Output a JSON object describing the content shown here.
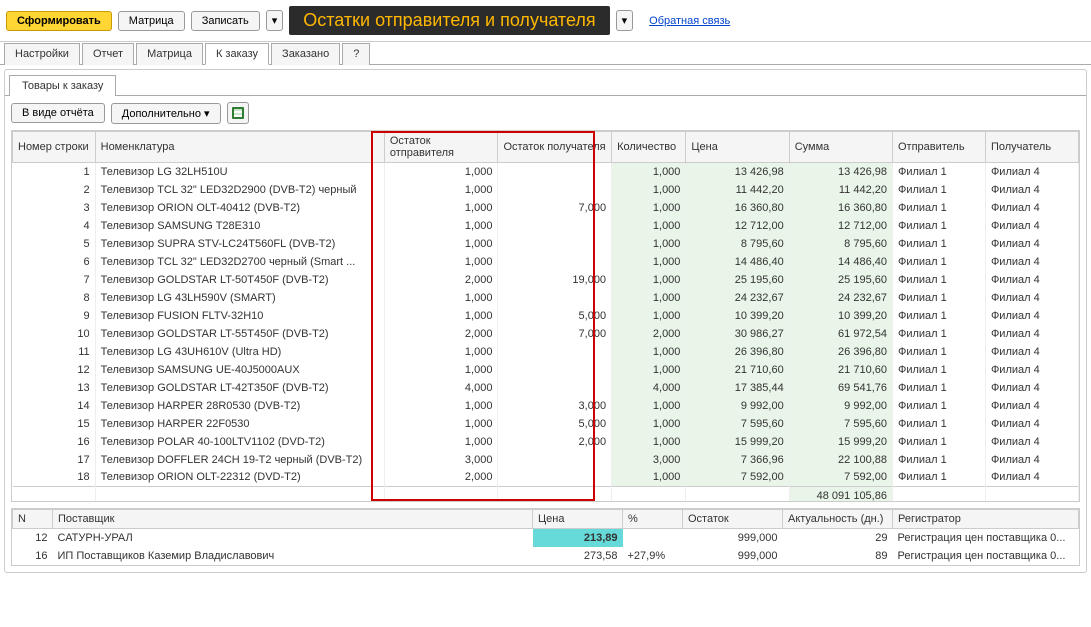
{
  "toolbar": {
    "form_button": "Сформировать",
    "matrix_button": "Матрица",
    "save_button": "Записать",
    "banner": "Остатки отправителя и получателя",
    "feedback_link": "Обратная связь"
  },
  "tabs_main": {
    "settings": "Настройки",
    "report": "Отчет",
    "matrix": "Матрица",
    "to_order": "К заказу",
    "ordered": "Заказано",
    "help": "?"
  },
  "tabs_sub": {
    "goods_to_order": "Товары к заказу"
  },
  "subtoolbar": {
    "report_view": "В виде отчёта",
    "additional": "Дополнительно"
  },
  "grid_headers": {
    "row_num": "Номер строки",
    "nomenclature": "Номенклатура",
    "sender_stock": "Остаток отправителя",
    "receiver_stock": "Остаток получателя",
    "quantity": "Количество",
    "price": "Цена",
    "sum": "Сумма",
    "sender": "Отправитель",
    "receiver": "Получатель"
  },
  "rows": [
    {
      "n": 1,
      "name": "Телевизор LG 32LH510U",
      "ostotp": "1,000",
      "ostpol": "",
      "qty": "1,000",
      "price": "13 426,98",
      "sum": "13 426,98",
      "otp": "Филиал 1",
      "pol": "Филиал 4"
    },
    {
      "n": 2,
      "name": "Телевизор TCL 32\" LED32D2900 (DVB-T2) черный",
      "ostotp": "1,000",
      "ostpol": "",
      "qty": "1,000",
      "price": "11 442,20",
      "sum": "11 442,20",
      "otp": "Филиал 1",
      "pol": "Филиал 4"
    },
    {
      "n": 3,
      "name": "Телевизор ORION OLT-40412 (DVB-T2)",
      "ostotp": "1,000",
      "ostpol": "7,000",
      "qty": "1,000",
      "price": "16 360,80",
      "sum": "16 360,80",
      "otp": "Филиал 1",
      "pol": "Филиал 4"
    },
    {
      "n": 4,
      "name": "Телевизор SAMSUNG T28E310",
      "ostotp": "1,000",
      "ostpol": "",
      "qty": "1,000",
      "price": "12 712,00",
      "sum": "12 712,00",
      "otp": "Филиал 1",
      "pol": "Филиал 4"
    },
    {
      "n": 5,
      "name": "Телевизор SUPRA STV-LC24T560FL (DVB-T2)",
      "ostotp": "1,000",
      "ostpol": "",
      "qty": "1,000",
      "price": "8 795,60",
      "sum": "8 795,60",
      "otp": "Филиал 1",
      "pol": "Филиал 4"
    },
    {
      "n": 6,
      "name": "Телевизор TCL 32\" LED32D2700 черный (Smart ...",
      "ostotp": "1,000",
      "ostpol": "",
      "qty": "1,000",
      "price": "14 486,40",
      "sum": "14 486,40",
      "otp": "Филиал 1",
      "pol": "Филиал 4"
    },
    {
      "n": 7,
      "name": "Телевизор GOLDSTAR LT-50T450F (DVB-T2)",
      "ostotp": "2,000",
      "ostpol": "19,000",
      "qty": "1,000",
      "price": "25 195,60",
      "sum": "25 195,60",
      "otp": "Филиал 1",
      "pol": "Филиал 4"
    },
    {
      "n": 8,
      "name": "Телевизор LG 43LH590V (SMART)",
      "ostotp": "1,000",
      "ostpol": "",
      "qty": "1,000",
      "price": "24 232,67",
      "sum": "24 232,67",
      "otp": "Филиал 1",
      "pol": "Филиал 4"
    },
    {
      "n": 9,
      "name": "Телевизор FUSION FLTV-32H10",
      "ostotp": "1,000",
      "ostpol": "5,000",
      "qty": "1,000",
      "price": "10 399,20",
      "sum": "10 399,20",
      "otp": "Филиал 1",
      "pol": "Филиал 4"
    },
    {
      "n": 10,
      "name": "Телевизор GOLDSTAR LT-55T450F (DVB-T2)",
      "ostotp": "2,000",
      "ostpol": "7,000",
      "qty": "2,000",
      "price": "30 986,27",
      "sum": "61 972,54",
      "otp": "Филиал 1",
      "pol": "Филиал 4"
    },
    {
      "n": 11,
      "name": "Телевизор LG 43UH610V (Ultra HD)",
      "ostotp": "1,000",
      "ostpol": "",
      "qty": "1,000",
      "price": "26 396,80",
      "sum": "26 396,80",
      "otp": "Филиал 1",
      "pol": "Филиал 4"
    },
    {
      "n": 12,
      "name": "Телевизор SAMSUNG UE-40J5000AUX",
      "ostotp": "1,000",
      "ostpol": "",
      "qty": "1,000",
      "price": "21 710,60",
      "sum": "21 710,60",
      "otp": "Филиал 1",
      "pol": "Филиал 4"
    },
    {
      "n": 13,
      "name": "Телевизор GOLDSTAR LT-42T350F (DVB-T2)",
      "ostotp": "4,000",
      "ostpol": "",
      "qty": "4,000",
      "price": "17 385,44",
      "sum": "69 541,76",
      "otp": "Филиал 1",
      "pol": "Филиал 4"
    },
    {
      "n": 14,
      "name": "Телевизор HARPER 28R0530 (DVB-T2)",
      "ostotp": "1,000",
      "ostpol": "3,000",
      "qty": "1,000",
      "price": "9 992,00",
      "sum": "9 992,00",
      "otp": "Филиал 1",
      "pol": "Филиал 4"
    },
    {
      "n": 15,
      "name": "Телевизор HARPER 22F0530",
      "ostotp": "1,000",
      "ostpol": "5,000",
      "qty": "1,000",
      "price": "7 595,60",
      "sum": "7 595,60",
      "otp": "Филиал 1",
      "pol": "Филиал 4"
    },
    {
      "n": 16,
      "name": "Телевизор POLAR 40-100LTV1102 (DVD-T2)",
      "ostotp": "1,000",
      "ostpol": "2,000",
      "qty": "1,000",
      "price": "15 999,20",
      "sum": "15 999,20",
      "otp": "Филиал 1",
      "pol": "Филиал 4"
    },
    {
      "n": 17,
      "name": "Телевизор DOFFLER 24CH 19-T2 черный (DVB-T2)",
      "ostotp": "3,000",
      "ostpol": "",
      "qty": "3,000",
      "price": "7 366,96",
      "sum": "22 100,88",
      "otp": "Филиал 1",
      "pol": "Филиал 4"
    },
    {
      "n": 18,
      "name": "Телевизор ORION OLT-22312 (DVD-T2)",
      "ostotp": "2,000",
      "ostpol": "",
      "qty": "1,000",
      "price": "7 592,00",
      "sum": "7 592,00",
      "otp": "Филиал 1",
      "pol": "Филиал 4"
    }
  ],
  "totals": {
    "sum": "48 091 105,86"
  },
  "bottom_headers": {
    "n": "N",
    "supplier": "Поставщик",
    "price": "Цена",
    "percent": "%",
    "stock": "Остаток",
    "relevance": "Актуальность (дн.)",
    "registrar": "Регистратор"
  },
  "bottom_rows": [
    {
      "n": "12",
      "supplier": "САТУРН-УРАЛ",
      "price": "213,89",
      "percent": "",
      "stock": "999,000",
      "relevance": "29",
      "registrar": "Регистрация цен поставщика 0...",
      "hl": true
    },
    {
      "n": "16",
      "supplier": "ИП Поставщиков Каземир Владиславович",
      "price": "273,58",
      "percent": "+27,9%",
      "stock": "999,000",
      "relevance": "89",
      "registrar": "Регистрация цен поставщика 0...",
      "hl": false
    }
  ]
}
